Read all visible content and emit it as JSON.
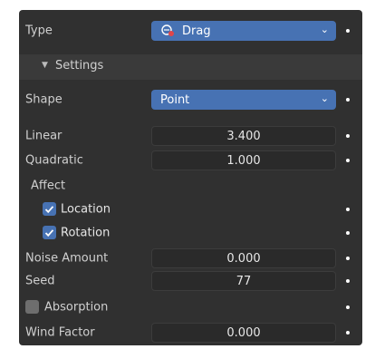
{
  "type_row": {
    "label": "Type",
    "value": "Drag"
  },
  "settings_header": {
    "label": "Settings"
  },
  "shape_row": {
    "label": "Shape",
    "value": "Point"
  },
  "linear_row": {
    "label": "Linear",
    "value": "3.400"
  },
  "quadratic_row": {
    "label": "Quadratic",
    "value": "1.000"
  },
  "affect": {
    "label": "Affect",
    "location": {
      "label": "Location",
      "checked": true
    },
    "rotation": {
      "label": "Rotation",
      "checked": true
    }
  },
  "noise_row": {
    "label": "Noise Amount",
    "value": "0.000"
  },
  "seed_row": {
    "label": "Seed",
    "value": "77"
  },
  "absorption": {
    "label": "Absorption",
    "checked": false
  },
  "wind_row": {
    "label": "Wind Factor",
    "value": "0.000"
  },
  "colors": {
    "panel": "#303030",
    "accent": "#4772b3",
    "field": "#545454",
    "field_dark": "#2a2a2a"
  }
}
